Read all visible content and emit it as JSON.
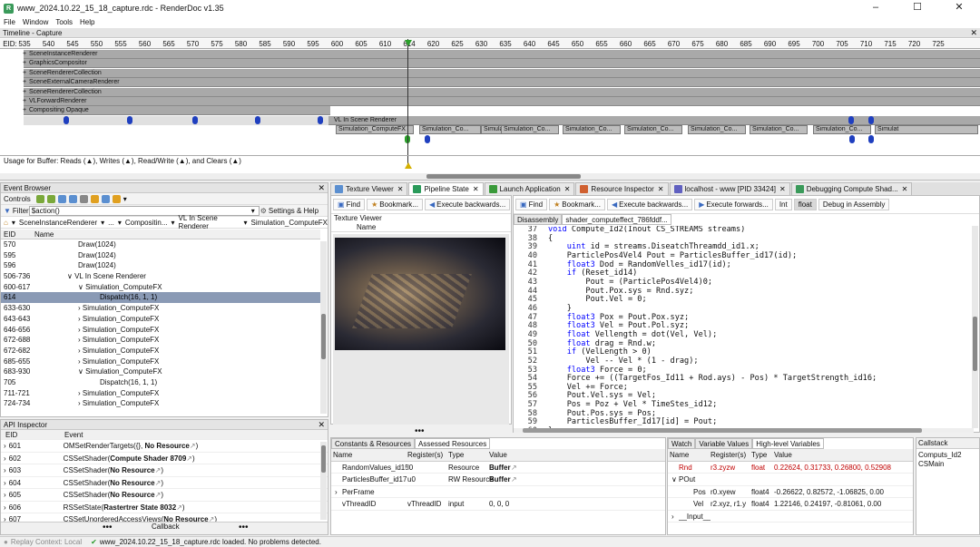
{
  "window": {
    "title": "www_2024.10.22_15_18_capture.rdc - RenderDoc v1.35",
    "app_icon": "renderdoc-logo-icon"
  },
  "menu": [
    "File",
    "Window",
    "Tools",
    "Help"
  ],
  "timeline": {
    "title": "Timeline - Capture",
    "eid_label": "EID:",
    "ticks": [
      "535",
      "540",
      "545",
      "550",
      "555",
      "560",
      "565",
      "570",
      "575",
      "580",
      "585",
      "590",
      "595",
      "600",
      "605",
      "610",
      "614",
      "620",
      "625",
      "630",
      "635",
      "640",
      "645",
      "650",
      "655",
      "660",
      "665",
      "670",
      "675",
      "680",
      "685",
      "690",
      "695",
      "700",
      "705",
      "710",
      "715",
      "720",
      "725"
    ],
    "sections": [
      "SceneInstanceRenderer",
      "GraphicsCompositor",
      "SceneRendererCollection",
      "SceneExternalCameraRenderer",
      "SceneRendererCollection",
      "VLForwardRenderer",
      "Compositing Opaque"
    ],
    "sub_section": "VL In Scene Renderer",
    "sim_segments": [
      "Simulation_ComputeFX",
      "Simulation_Co...",
      "Simulation_Co...",
      "Simulation_Co...",
      "Simulation_Co...",
      "Simulation_Co...",
      "Simulation_Co...",
      "Simulation_Co...",
      "Simulation_Co...",
      "Simulat"
    ],
    "usage_text": "Usage for Buffer: Reads (▲), Writes (▲), Read/Write (▲), and Clears (▲)"
  },
  "event_browser": {
    "title": "Event Browser",
    "controls_label": "Controls",
    "filter_label": "Filter",
    "filter_value": "$action()",
    "settings_label": "Settings & Help",
    "breadcrumb": [
      "SceneInstanceRenderer",
      "...",
      "Compositin...",
      "VL In Scene Renderer",
      "Simulation_ComputeFX"
    ],
    "columns": [
      "EID",
      "Name"
    ],
    "rows": [
      {
        "eid": "570",
        "name": "Draw(1024)",
        "indent": 4
      },
      {
        "eid": "595",
        "name": "Draw(1024)",
        "indent": 4
      },
      {
        "eid": "596",
        "name": "Draw(1024)",
        "indent": 4
      },
      {
        "eid": "506-736",
        "name": "∨ VL In Scene Renderer",
        "indent": 3
      },
      {
        "eid": "600-617",
        "name": "∨ Simulation_ComputeFX",
        "indent": 4
      },
      {
        "eid": "614",
        "name": "Dispatch(16, 1, 1)",
        "indent": 6,
        "selected": true
      },
      {
        "eid": "633-630",
        "name": "› Simulation_ComputeFX",
        "indent": 4
      },
      {
        "eid": "643-643",
        "name": "› Simulation_ComputeFX",
        "indent": 4
      },
      {
        "eid": "646-656",
        "name": "› Simulation_ComputeFX",
        "indent": 4
      },
      {
        "eid": "672-688",
        "name": "› Simulation_ComputeFX",
        "indent": 4
      },
      {
        "eid": "672-682",
        "name": "› Simulation_ComputeFX",
        "indent": 4
      },
      {
        "eid": "685-655",
        "name": "› Simulation_ComputeFX",
        "indent": 4
      },
      {
        "eid": "683-930",
        "name": "∨ Simulation_ComputeFX",
        "indent": 4
      },
      {
        "eid": "705",
        "name": "Dispatch(16, 1, 1)",
        "indent": 6
      },
      {
        "eid": "711-721",
        "name": "› Simulation_ComputeFX",
        "indent": 4
      },
      {
        "eid": "724-734",
        "name": "› Simulation_ComputeFX",
        "indent": 4
      }
    ]
  },
  "api_inspector": {
    "title": "API Inspector",
    "columns": [
      "EID",
      "Event"
    ],
    "rows": [
      {
        "eid": "601",
        "prefix": "OMSetRenderTargets({}, ",
        "bold": "No Resource",
        "suffix": ")"
      },
      {
        "eid": "602",
        "prefix": "CSSetShader(",
        "bold": "Compute Shader 8709",
        "suffix": ")"
      },
      {
        "eid": "603",
        "prefix": "CSSetShader(",
        "bold": "No Resource",
        "suffix": ")"
      },
      {
        "eid": "604",
        "prefix": "CSSetShader(",
        "bold": "No Resource",
        "suffix": ")"
      },
      {
        "eid": "605",
        "prefix": "CSSetShader(",
        "bold": "No Resource",
        "suffix": ")"
      },
      {
        "eid": "606",
        "prefix": "RSSetState(",
        "bold": "Rastertrer State 8032",
        "suffix": ")"
      },
      {
        "eid": "607",
        "prefix": "CSSetUnorderedAccessViews(",
        "bold": "No Resource",
        "suffix": ")"
      }
    ],
    "callback_label": "Callback"
  },
  "tabs": [
    {
      "label": "Texture Viewer",
      "icon": "texture-icon",
      "active": false
    },
    {
      "label": "Pipeline State",
      "icon": "pipeline-icon",
      "active": true
    },
    {
      "label": "Launch Application",
      "icon": "launch-icon",
      "active": false
    },
    {
      "label": "Resource Inspector",
      "icon": "resource-icon",
      "active": false
    },
    {
      "label": "localhost - www [PID 33424]",
      "icon": "connection-icon",
      "active": false
    },
    {
      "label": "Debugging Compute Shad...",
      "icon": "debug-icon",
      "active": false
    }
  ],
  "texture_viewer": {
    "find": "Find",
    "bookmark": "Bookmark...",
    "execute_back": "Execute backwards...",
    "subtitle": "Texture Viewer",
    "col": "Name"
  },
  "shader": {
    "find": "Find",
    "bookmark": "Bookmark...",
    "execute_back": "Execute backwards...",
    "execute_fwd": "Execute forwards...",
    "int": "Int",
    "float": "float",
    "debug_asm": "Debug in Assembly",
    "tab_disasm": "Disassembly",
    "tab_file": "shader_computeffect_786fddf...",
    "lines": [
      {
        "n": "37",
        "t": "void Compute_Id2(Inout CS_STREAMS streams)"
      },
      {
        "n": "38",
        "t": "{"
      },
      {
        "n": "39",
        "t": "    uint id = streams.DiseatchThreamdd_id1.x;"
      },
      {
        "n": "40",
        "t": "    ParticlePos4Vel4 Pout = ParticlesBuffer_id17(id);"
      },
      {
        "n": "41",
        "t": "    float3 Dod = RandomVelles_id17(id);"
      },
      {
        "n": "42",
        "t": "    if (Reset_id14)"
      },
      {
        "n": "43",
        "t": "        Pout = (ParticlePos4Vel4)0;"
      },
      {
        "n": "44",
        "t": "        Pout.Pox.sys = Rnd.syz;"
      },
      {
        "n": "45",
        "t": "        Pout.Vel = 0;"
      },
      {
        "n": "46",
        "t": "    }"
      },
      {
        "n": "47",
        "t": "    float3 Pox = Pout.Pox.syz;"
      },
      {
        "n": "48",
        "t": "    float3 Vel = Pout.Pol.syz;"
      },
      {
        "n": "49",
        "t": "    float Vellength = dot(Vel, Vel);"
      },
      {
        "n": "50",
        "t": "    float drag = Rnd.w;"
      },
      {
        "n": "51",
        "t": "    if (VelLength > 0)"
      },
      {
        "n": "52",
        "t": "        Vel -- Vel * (1 - drag);"
      },
      {
        "n": "53",
        "t": "    float3 Force = 0;"
      },
      {
        "n": "54",
        "t": "    Force += ((TargetFos_Id11 + Rod.ays) - Pos) * TargetStrength_id16;"
      },
      {
        "n": "55",
        "t": "    Vel += Force;"
      },
      {
        "n": "56",
        "t": "    Pout.Vel.sys = Vel;"
      },
      {
        "n": "57",
        "t": "    Pos = Poz + Vel * TimeStes_id12;"
      },
      {
        "n": "58",
        "t": "    Pout.Pos.sys = Pos;"
      },
      {
        "n": "59",
        "t": "    ParticlesBuffer_Id17[id] = Pout;"
      },
      {
        "n": "60",
        "t": "}"
      }
    ]
  },
  "constants": {
    "tab1": "Constants & Resources",
    "tab2": "Assessed Resources",
    "columns": [
      "Name",
      "Register(s)",
      "Type",
      "Value"
    ],
    "rows": [
      {
        "exp": "",
        "name": "RandomValues_id15",
        "reg": "l0",
        "type": "Resource",
        "value": "Buffer"
      },
      {
        "exp": "",
        "name": "ParticlesBuffer_id17",
        "reg": "u0",
        "type": "RW Resource",
        "value": "Buffer"
      },
      {
        "exp": "›",
        "name": "PerFrame",
        "reg": "",
        "type": "",
        "value": ""
      },
      {
        "exp": "",
        "name": "vThreadID",
        "reg": "vThreadID",
        "type": "input",
        "value": "0, 0, 0"
      }
    ]
  },
  "watch": {
    "tab1": "Watch",
    "tab2": "Variable Values",
    "tab3": "High-level Variables",
    "columns": [
      "Name",
      "Register(s)",
      "Type",
      "Value"
    ],
    "rows": [
      {
        "exp": "",
        "name": "Rnd",
        "reg": "r3.zyzw",
        "type": "float",
        "value": "0.22624, 0.31733, 0.26800, 0.52908",
        "red": true
      },
      {
        "exp": "∨",
        "name": "POut",
        "reg": "",
        "type": "",
        "value": "",
        "red": false
      },
      {
        "exp": "",
        "name": "Pos",
        "reg": "r0.xyew",
        "type": "float4",
        "value": "-0.26622, 0.82572, -1.06825, 0.00",
        "red": false,
        "indent": true
      },
      {
        "exp": "",
        "name": "Vel",
        "reg": "r2.xyz, r1.y",
        "type": "float4",
        "value": "1.22146, 0.24197, -0.81061, 0.00",
        "red": false,
        "indent": true
      },
      {
        "exp": "›",
        "name": "__Input__",
        "reg": "",
        "type": "",
        "value": "",
        "red": false
      }
    ]
  },
  "callstack": {
    "title": "Callstack",
    "items": [
      "Computs_Id2",
      "CSMain"
    ]
  },
  "status": {
    "replay": "Replay Context: Local",
    "message": "www_2024.10.22_15_18_capture.rdc loaded. No problems detected."
  }
}
